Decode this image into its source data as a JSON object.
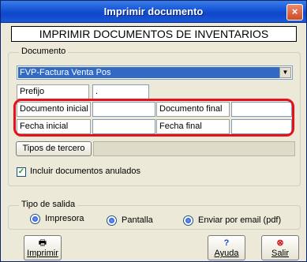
{
  "window": {
    "title": "Imprimir documento",
    "close_glyph": "×"
  },
  "heading": "IMPRIMIR DOCUMENTOS DE INVENTARIOS",
  "documento_group": {
    "label": "Documento",
    "selected_document": "FVP-Factura Venta Pos",
    "prefijo_label": "Prefijo",
    "prefijo_value": ".",
    "documento_inicial_label": "Documento inicial",
    "documento_inicial_value": "",
    "documento_final_label": "Documento final",
    "documento_final_value": "",
    "fecha_inicial_label": "Fecha inicial",
    "fecha_inicial_value": "",
    "fecha_final_label": "Fecha final",
    "fecha_final_value": "",
    "tipos_tercero_button": "Tipos de tercero",
    "tipos_tercero_value": "",
    "incluir_anulados_label": "Incluir documentos anulados",
    "incluir_anulados_checked": true
  },
  "salida_group": {
    "label": "Tipo de salida",
    "options": [
      {
        "label": "Impresora",
        "selected": true
      },
      {
        "label": "Pantalla",
        "selected": true
      },
      {
        "label": "Enviar por email (pdf)",
        "selected": true
      }
    ]
  },
  "buttons": {
    "imprimir": "Imprimir",
    "ayuda": "Ayuda",
    "salir": "Salir"
  },
  "icons": {
    "printer": "printer-icon",
    "help": "help-icon",
    "exit": "exit-icon",
    "dropdown": "chevron-down-icon",
    "check": "checkmark-icon"
  },
  "colors": {
    "titlebar": "#1553d6",
    "selection": "#316ac5",
    "highlight": "#e8101a",
    "background": "#ece9d8"
  }
}
